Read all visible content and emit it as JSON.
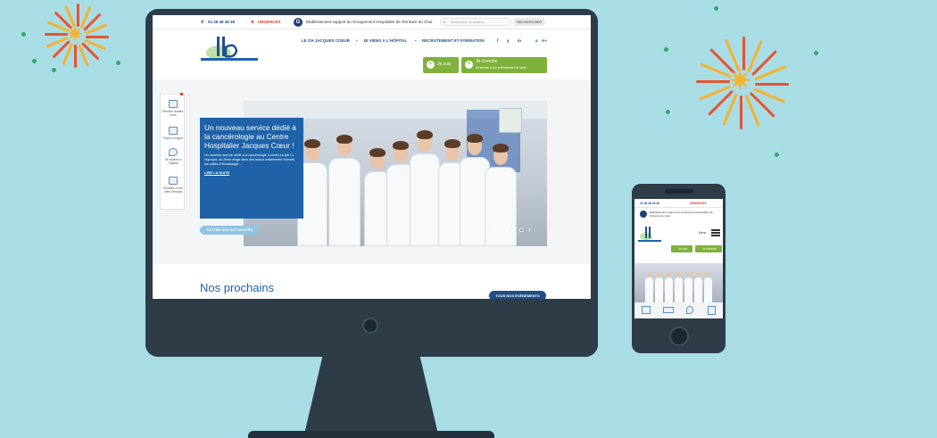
{
  "colors": {
    "background": "#a8dde6",
    "accent_blue": "#1f62a8",
    "accent_green": "#7fb23a",
    "red": "#d93a2b",
    "frame": "#2e3c48"
  },
  "topbar": {
    "phone_icon": "phone-icon",
    "phone": "02 48 48 48 48",
    "urgent_icon": "medical-cross-icon",
    "urgent": "URGENCES",
    "gh_text": "Établissement support du Groupement Hospitalier de Territoire du Cher",
    "search_placeholder": "Rechercher un contenu...",
    "search_button": "RECHERCHER"
  },
  "nav": {
    "items": [
      "LE CH JACQUES COEUR",
      "JE VIENS À L'HÔPITAL",
      "RECRUTEMENT ET FORMATION"
    ],
    "social": [
      "f",
      "y",
      "in"
    ],
    "font_controls": [
      "a",
      "A+"
    ]
  },
  "cta": {
    "je_suis": "Je suis",
    "je_cherche": "Je cherche",
    "je_cherche_sub": "Un service ou un professionnel de santé"
  },
  "tools": [
    "Prendre rendez-vous",
    "Payer en ligne",
    "Se repérer à l'hôpital",
    "Postuler à une offre d'emploi"
  ],
  "news": {
    "title": "Un nouveau service dédié à la cancérologie au Centre Hospitalier Jacques Cœur !",
    "text": "Un nouveau service dédié à la cancérologie a ouvert en juin ! Il regroupe, au 2ème étage dans des locaux entièrement rénovés, les unités d'hématologie ...",
    "more": "LIRE LA SUITE",
    "all": "TOUTES NOS ACTUALITÉS"
  },
  "events": {
    "title": "Nos prochains",
    "button": "TOUS NOS ÉVÉNEMENTS"
  },
  "phone_ui": {
    "phone": "02 48 48 48 48",
    "urgent": "URGENCES",
    "gh_text": "Établissement support du Groupement Hospitalier de Territoire du Cher",
    "menu": "Menu",
    "je_suis": "Je suis",
    "je_cherche": "Je cherche"
  }
}
